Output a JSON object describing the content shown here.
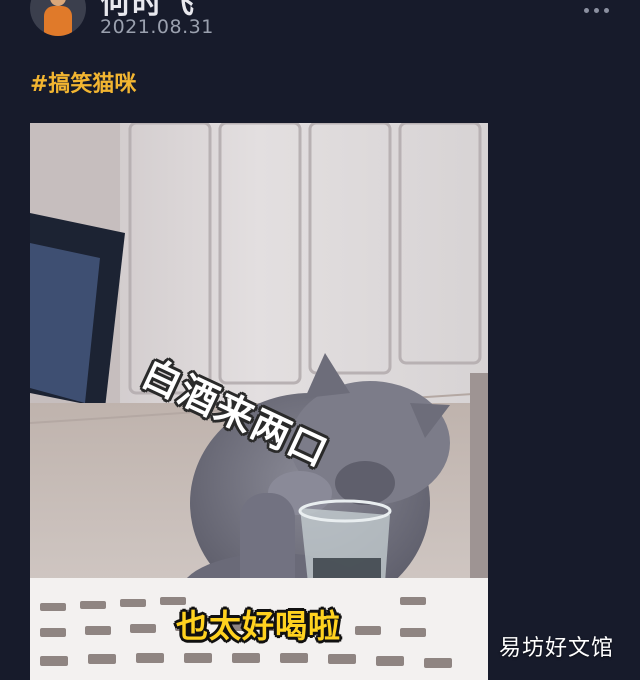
{
  "post": {
    "author": {
      "name": "何时飞",
      "date": "2021.08.31"
    },
    "hashtag": "#搞笑猫咪",
    "image": {
      "caption_top": "白酒来两口",
      "caption_bottom": "也太好喝啦"
    }
  },
  "watermark": "易坊好文馆",
  "colors": {
    "background": "#171b2b",
    "hashtag": "#f2b531",
    "caption_bottom": "#ffd21f"
  },
  "icons": {
    "more": "more-dots-icon"
  }
}
